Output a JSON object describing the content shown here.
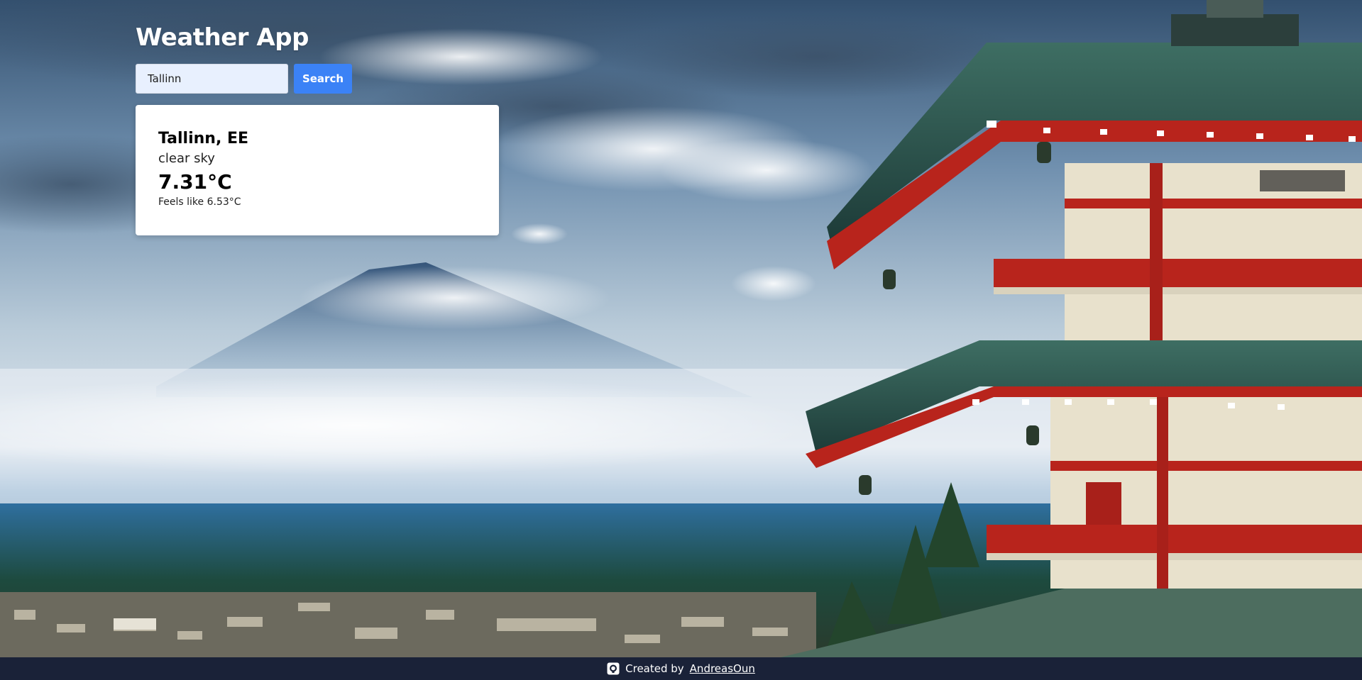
{
  "app": {
    "title": "Weather App"
  },
  "search": {
    "value": "Tallinn",
    "button_label": "Search"
  },
  "weather": {
    "location": "Tallinn, EE",
    "description": "clear sky",
    "temperature": "7.31°C",
    "feels_like": "Feels like 6.53°C"
  },
  "footer": {
    "icon": "github-icon",
    "prefix": "Created by",
    "author_link": "AndreasOun"
  },
  "colors": {
    "accent": "#3b82f6",
    "input_bg": "#e8f0fe",
    "footer_bg": "#1a2238",
    "card_bg": "#ffffff"
  }
}
